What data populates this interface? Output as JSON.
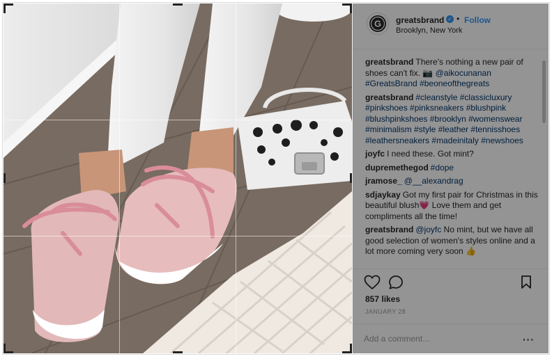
{
  "post": {
    "username": "greatsbrand",
    "verified_mark": "✓",
    "separator": "•",
    "follow_label": "Follow",
    "location": "Brooklyn, New York",
    "likes": "857 likes",
    "date": "JANUARY 28",
    "comment_placeholder": "Add a comment…",
    "more_label": "···"
  },
  "comments": [
    {
      "user": "greatsbrand",
      "parts": [
        {
          "t": "There's nothing a new pair of shoes can't fix. "
        },
        {
          "t": "📷 "
        },
        {
          "t": "@aikocunanan",
          "tag": true
        },
        {
          "t": " "
        },
        {
          "t": "#GreatsBrand",
          "tag": true
        },
        {
          "t": " "
        },
        {
          "t": "#beoneofthegreats",
          "tag": true
        }
      ]
    },
    {
      "user": "greatsbrand",
      "parts": [
        {
          "t": "#cleanstyle #classicluxury #pinkshoes #pinksneakers #blushpink #blushpinkshoes #brooklyn #womenswear #minimalism #style #leather #tennisshoes #leathersneakers #madeinitaly #newshoes",
          "tag": true
        }
      ]
    },
    {
      "user": "joyfc",
      "parts": [
        {
          "t": "I need these. Got mint?"
        }
      ]
    },
    {
      "user": "dupremethegod",
      "parts": [
        {
          "t": "#dope",
          "tag": true
        }
      ]
    },
    {
      "user": "jramose_",
      "parts": [
        {
          "t": "@__alexandrag",
          "tag": true
        }
      ]
    },
    {
      "user": "sdjaykay",
      "parts": [
        {
          "t": "Got my first pair for Christmas in this beautiful blush"
        },
        {
          "t": "💗"
        },
        {
          "t": " Love them and get compliments all the time!"
        }
      ]
    },
    {
      "user": "greatsbrand",
      "parts": [
        {
          "t": "@joyfc",
          "tag": true
        },
        {
          "t": " No mint, but we have all good selection of women's styles online and a lot more coming very soon "
        },
        {
          "t": "👍"
        }
      ]
    }
  ],
  "icons": {
    "avatar": "g-logo-icon",
    "like": "heart-icon",
    "comment": "comment-bubble-icon",
    "save": "bookmark-icon"
  },
  "colors": {
    "link": "#3897f0",
    "hashtag": "#003569",
    "sidebar_overlay": "rgba(0,0,0,0.42)"
  }
}
